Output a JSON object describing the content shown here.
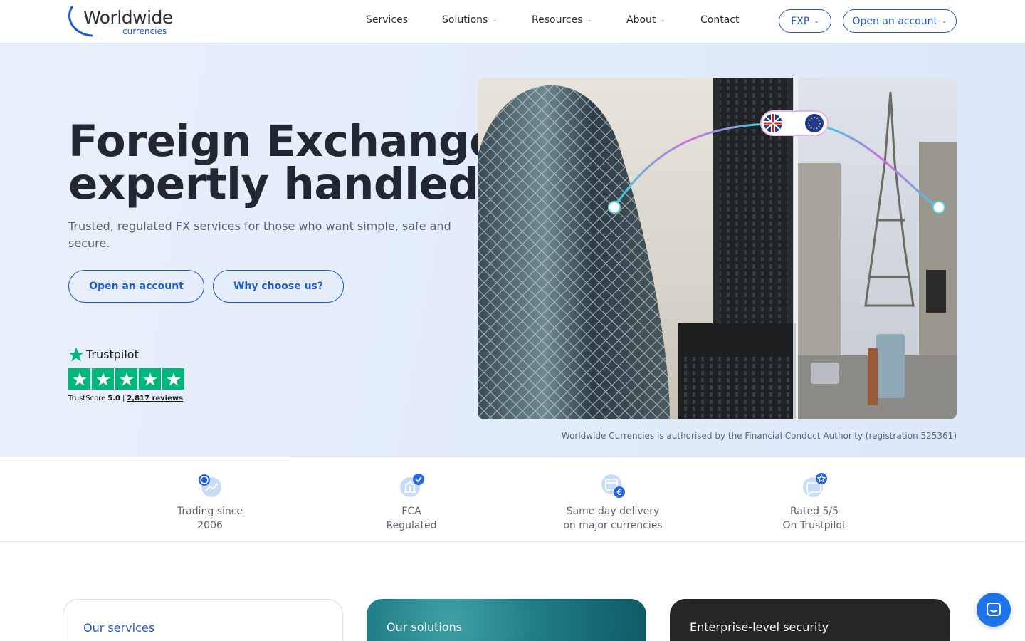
{
  "header": {
    "logo_word": "Worldwide",
    "logo_sub": "currencies",
    "nav": {
      "services": "Services",
      "solutions": "Solutions",
      "resources": "Resources",
      "about": "About",
      "contact": "Contact"
    },
    "fxp_label": "FXP",
    "open_account_label": "Open an account"
  },
  "hero": {
    "title_line1": "Foreign Exchange,",
    "title_line2": "expertly handled.",
    "subtitle": "Trusted, regulated FX services for those who want simple, safe and secure.",
    "primary_button": "Open an account",
    "secondary_button": "Why choose us?",
    "fca_note": "Worldwide Currencies is authorised by the Financial Conduct Authority (registration 525361)"
  },
  "trustpilot": {
    "brand": "Trustpilot",
    "score_label": "TrustScore",
    "score": "5.0",
    "separator": "|",
    "reviews": "2,817 reviews",
    "star_color": "#00b67a",
    "stars": 5
  },
  "features": [
    {
      "line1": "Trading since",
      "line2": "2006",
      "icon": "clock-trend-icon"
    },
    {
      "line1": "FCA",
      "line2": "Regulated",
      "icon": "bank-check-icon"
    },
    {
      "line1": "Same day delivery",
      "line2": "on major currencies",
      "icon": "calendar-euro-icon"
    },
    {
      "line1": "Rated 5/5",
      "line2": "On Trustpilot",
      "icon": "chat-star-icon"
    }
  ],
  "cards": {
    "services": "Our services",
    "solutions": "Our solutions",
    "security": "Enterprise-level security"
  },
  "colors": {
    "accent": "#1e5bd6",
    "hero_bg": "#e3ecfb",
    "chat_button": "#1e73e8"
  }
}
